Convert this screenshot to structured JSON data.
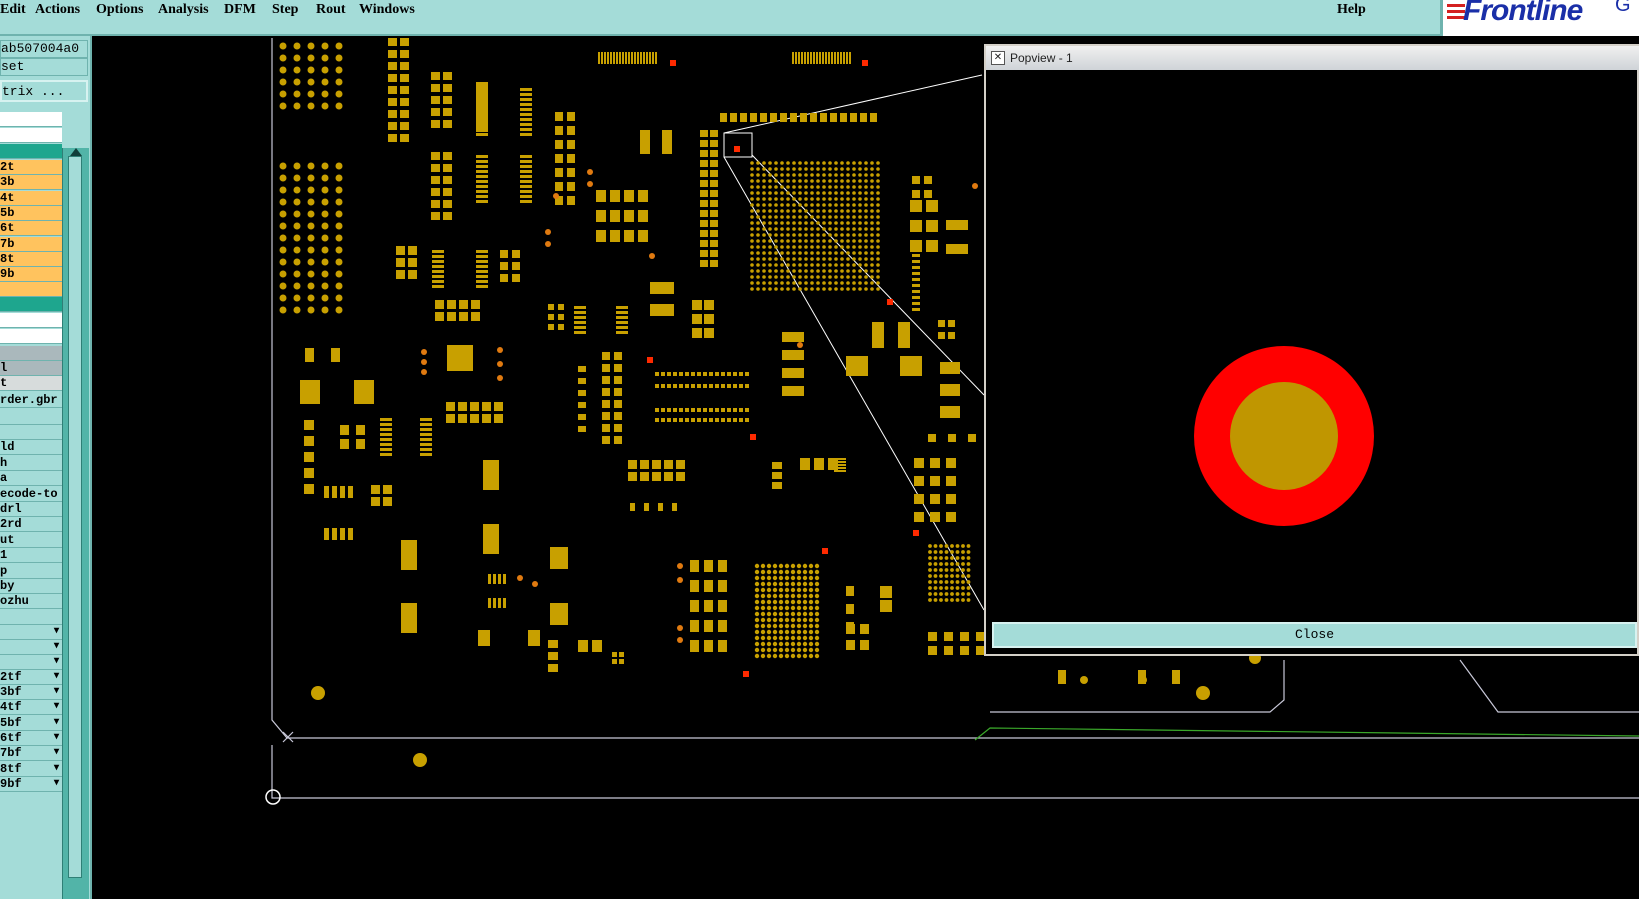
{
  "menu": {
    "items": [
      "Edit",
      "Actions",
      "Options",
      "Analysis",
      "DFM",
      "Step",
      "Rout",
      "Windows"
    ],
    "help": "Help"
  },
  "logo": {
    "text": "Frontline",
    "extra": "G"
  },
  "left_panel": {
    "job_name": "ab507004a0",
    "step_field": "set",
    "matrix_button": "trix ...",
    "layers": [
      {
        "label": "2t",
        "color": "orange"
      },
      {
        "label": "3b",
        "color": "orange"
      },
      {
        "label": "4t",
        "color": "orange"
      },
      {
        "label": "5b",
        "color": "orange"
      },
      {
        "label": "6t",
        "color": "orange"
      },
      {
        "label": "7b",
        "color": "orange"
      },
      {
        "label": "8t",
        "color": "orange"
      },
      {
        "label": "9b",
        "color": "orange"
      }
    ],
    "misc_rows": [
      "l",
      "t",
      "rder.gbr"
    ],
    "files": [
      "ld",
      "h",
      "a",
      "ecode-to",
      "drl",
      "2rd",
      "ut",
      "1",
      "p",
      "by",
      "ozhu"
    ],
    "film_rows": [
      "2tf",
      "3bf",
      "4tf",
      "5bf",
      "6tf",
      "7bf",
      "8tf",
      "9bf"
    ]
  },
  "popview": {
    "title": "Popview - 1",
    "close_label": "Close",
    "pad": {
      "outer_color": "#ff0000",
      "inner_color": "#c09600"
    }
  },
  "colors": {
    "pad": "#c8a000",
    "pad_orange": "#e07a10",
    "via": "#ff2a00",
    "outline": "#c8c8d8",
    "panel": "#a4dcd8"
  }
}
